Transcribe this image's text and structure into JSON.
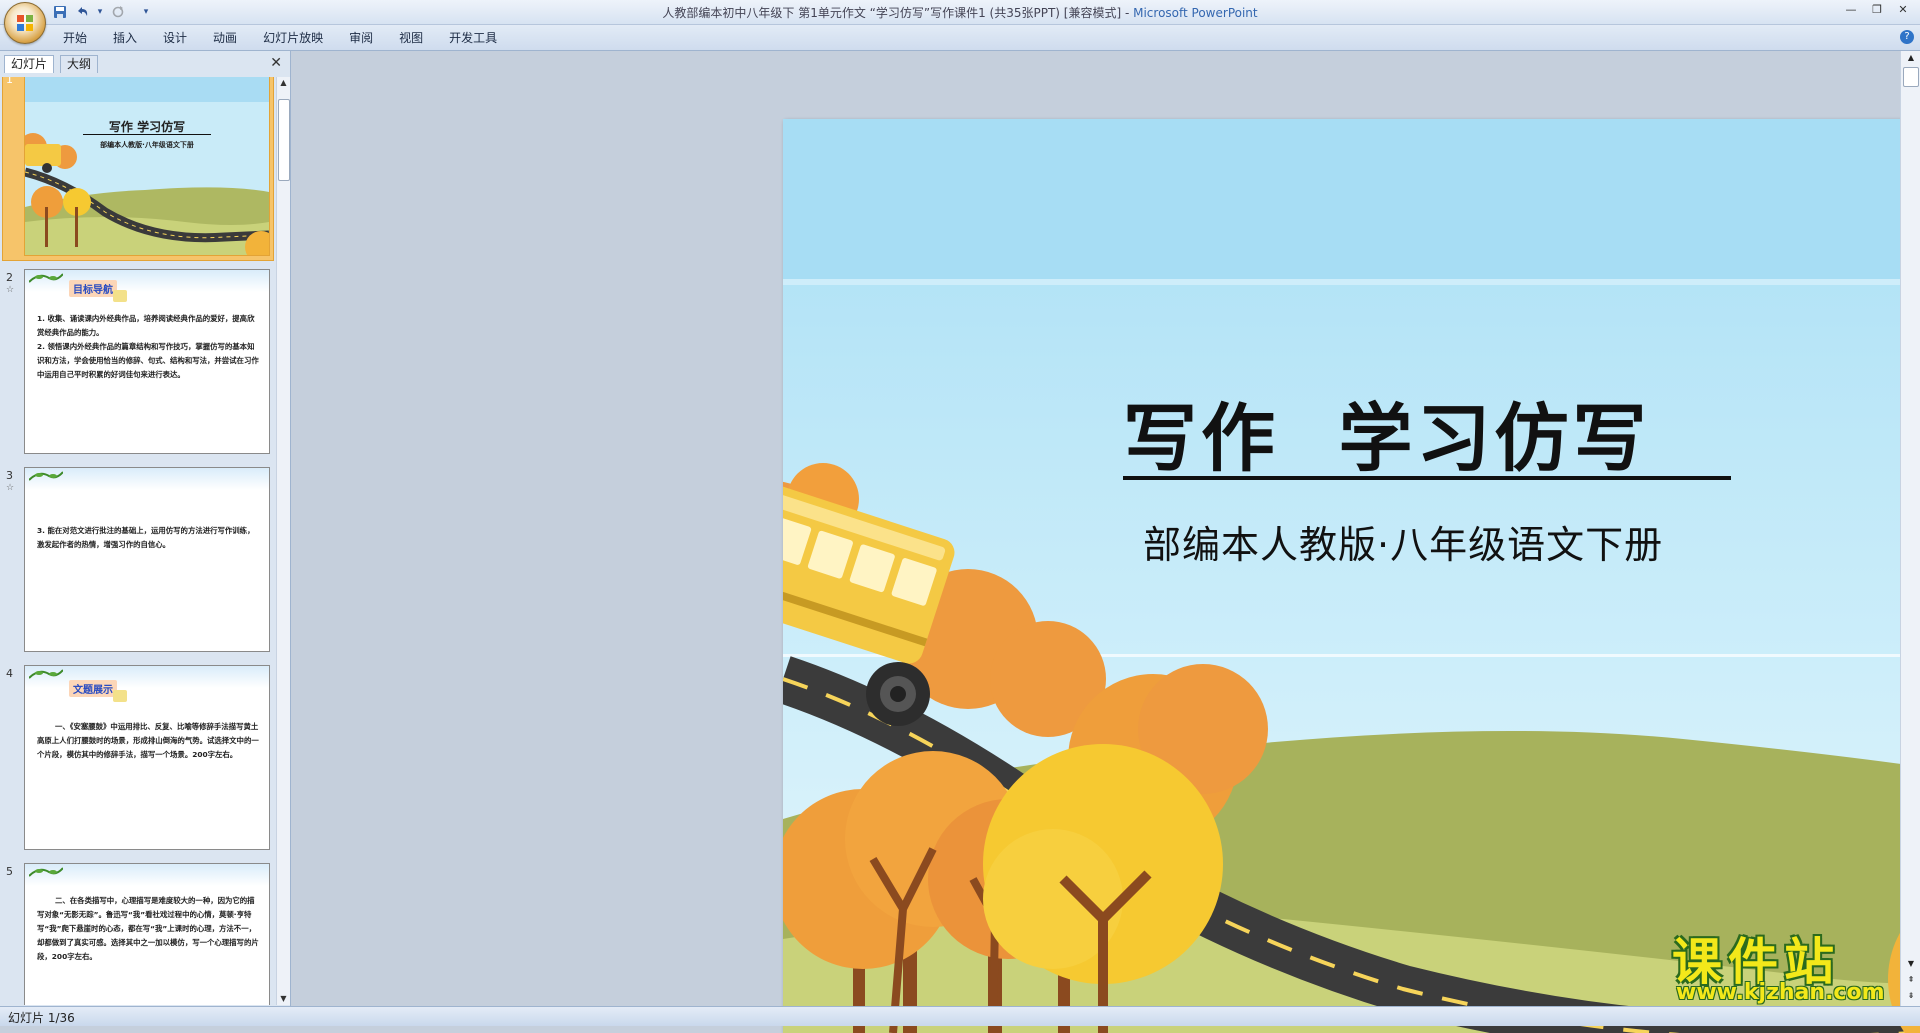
{
  "window": {
    "title": "人教部编本初中八年级下 第1单元作文 “学习仿写”写作课件1 (共35张PPT) [兼容模式] - ",
    "app_name": "Microsoft PowerPoint"
  },
  "quick_access": [
    {
      "name": "save-icon",
      "glyph": "💾"
    },
    {
      "name": "undo-icon",
      "glyph": "↶"
    },
    {
      "name": "dropdown-icon",
      "glyph": "▾"
    },
    {
      "name": "redo-icon",
      "glyph": "↷"
    },
    {
      "name": "customize-icon",
      "glyph": "▾"
    }
  ],
  "window_controls": {
    "minimize": "—",
    "restore": "❐",
    "close": "✕"
  },
  "ribbon_tabs": [
    "开始",
    "插入",
    "设计",
    "动画",
    "幻灯片放映",
    "审阅",
    "视图",
    "开发工具"
  ],
  "left_pane": {
    "tab_slides": "幻灯片",
    "tab_outline": "大纲",
    "close": "✕",
    "thumbnails": [
      {
        "num": "1",
        "title": "写作  学习仿写",
        "subtitle": "部编本人教版·八年级语文下册",
        "selected": true
      },
      {
        "num": "2",
        "star": "☆",
        "tag": "目标导航",
        "text": "1. 收集、诵读课内外经典作品，培养阅读经典作品的爱好，提高欣赏经典作品的能力。\n2. 领悟课内外经典作品的篇章结构和写作技巧，掌握仿写的基本知识和方法，学会使用恰当的修辞、句式、结构和写法，并尝试在习作中运用自己平时积累的好词佳句来进行表达。"
      },
      {
        "num": "3",
        "star": "☆",
        "text": "3. 能在对范文进行批注的基础上，运用仿写的方法进行写作训练，激发起作者的热情，增强习作的自信心。"
      },
      {
        "num": "4",
        "tag": "文题展示",
        "text": "一、《安塞腰鼓》中运用排比、反复、比喻等修辞手法描写黄土高原上人们打腰鼓时的场景，形成排山倒海的气势。试选择文中的一个片段，模仿其中的修辞手法，描写一个场景。200字左右。"
      },
      {
        "num": "5",
        "text": "二、在各类描写中，心理描写是难度较大的一种，因为它的描写对象“无影无踪”。鲁迅写“我”看社戏过程中的心情，莫顿·亨特写“我”爬下悬崖时的心态，都在写“我”上课时的心理，方法不一，却都做到了真实可感。选择其中之一加以模仿，写一个心理描写的片段，200字左右。"
      }
    ]
  },
  "slide": {
    "title": "写作  学习仿写",
    "subtitle": "部编本人教版·八年级语文下册"
  },
  "status": {
    "slide_counter": "幻灯片 1/36"
  },
  "watermark": {
    "title": "课件站",
    "url": "www.kjzhan.com"
  },
  "colors": {
    "sky": "#bfe6f6",
    "grass_dark": "#a7b25c",
    "grass_light": "#cad47a",
    "road": "#3b3b3b",
    "bus": "#f4c944",
    "orange_tree": "#ee9a3f",
    "yellow_tree": "#f6c931",
    "selection": "#f6c46a"
  }
}
